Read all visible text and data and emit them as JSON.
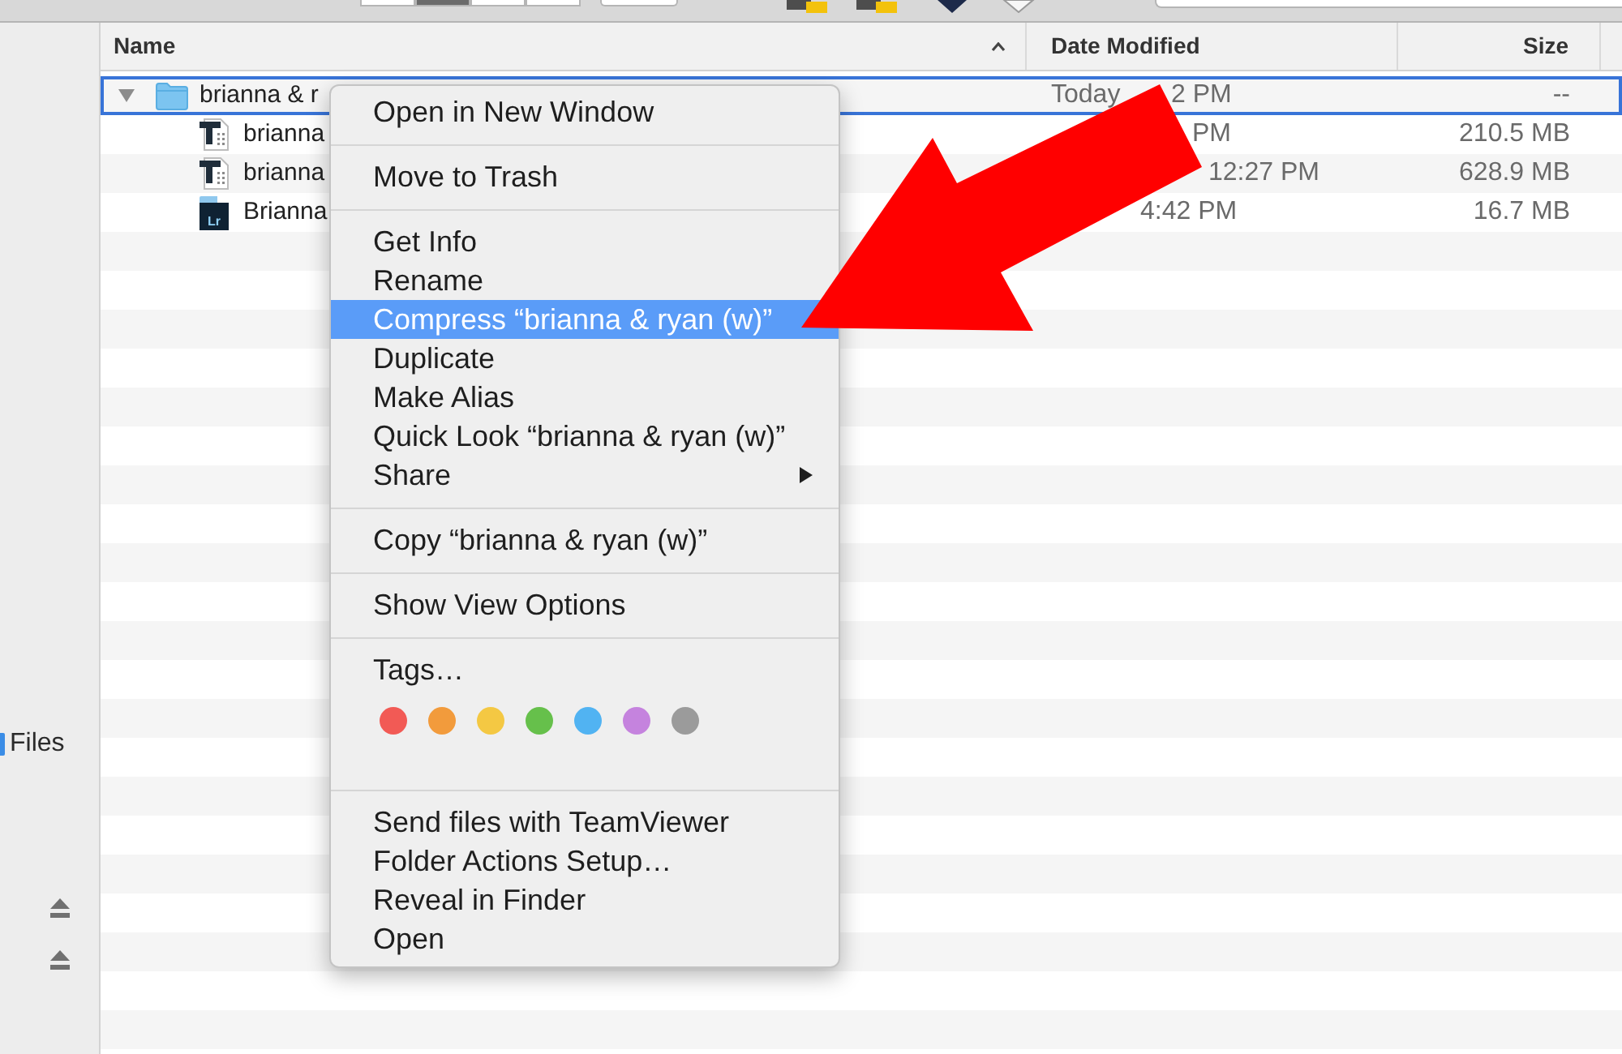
{
  "toolbar": {
    "view_modes": [
      {
        "selected": false
      },
      {
        "selected": true
      },
      {
        "selected": false
      },
      {
        "selected": false
      }
    ]
  },
  "sidebar": {
    "items": [
      {
        "kind": "place",
        "label": "Files"
      },
      {
        "kind": "device"
      },
      {
        "kind": "device"
      }
    ]
  },
  "table": {
    "columns": [
      {
        "label": "Name",
        "sorted": true
      },
      {
        "label": "Date Modified",
        "sorted": false
      },
      {
        "label": "Size",
        "sorted": false
      }
    ],
    "rows": [
      {
        "kind": "folder",
        "name": "brianna & r",
        "expanded": true,
        "selected": true,
        "date_modified": [
          "Today",
          "2 PM"
        ],
        "size": "--",
        "children": [
          {
            "kind": "document",
            "name": "brianna",
            "selected": false,
            "date_modified": [
              "PM"
            ],
            "size": "210.5 MB"
          },
          {
            "kind": "document",
            "name": "brianna",
            "selected": false,
            "date_modified": [
              "12:27 PM"
            ],
            "size": "628.9 MB"
          },
          {
            "kind": "catalog",
            "name": "Brianna",
            "icon_label": "Lr",
            "selected": false,
            "date_modified": [
              "4:42 PM"
            ],
            "size": "16.7 MB"
          }
        ]
      }
    ]
  },
  "context_menu": {
    "items": [
      {
        "kind": "item",
        "label": "Open in New Window",
        "selected": false,
        "submenu": false
      },
      {
        "kind": "separator"
      },
      {
        "kind": "item",
        "label": "Move to Trash",
        "selected": false,
        "submenu": false
      },
      {
        "kind": "separator"
      },
      {
        "kind": "item",
        "label": "Get Info",
        "selected": false,
        "submenu": false
      },
      {
        "kind": "item",
        "label": "Rename",
        "selected": false,
        "submenu": false
      },
      {
        "kind": "item",
        "label": "Compress “brianna & ryan (w)”",
        "selected": true,
        "submenu": false
      },
      {
        "kind": "item",
        "label": "Duplicate",
        "selected": false,
        "submenu": false
      },
      {
        "kind": "item",
        "label": "Make Alias",
        "selected": false,
        "submenu": false
      },
      {
        "kind": "item",
        "label": "Quick Look “brianna & ryan (w)”",
        "selected": false,
        "submenu": false
      },
      {
        "kind": "item",
        "label": "Share",
        "selected": false,
        "submenu": true
      },
      {
        "kind": "separator"
      },
      {
        "kind": "item",
        "label": "Copy “brianna & ryan (w)”",
        "selected": false,
        "submenu": false
      },
      {
        "kind": "separator"
      },
      {
        "kind": "item",
        "label": "Show View Options",
        "selected": false,
        "submenu": false
      },
      {
        "kind": "separator"
      },
      {
        "kind": "item",
        "label": "Tags…",
        "selected": false,
        "submenu": false
      },
      {
        "kind": "tag_colors",
        "colors": [
          {
            "color": "#f25a55"
          },
          {
            "color": "#f29b3c"
          },
          {
            "color": "#f4c843"
          },
          {
            "color": "#66c04b"
          },
          {
            "color": "#51b3f2"
          },
          {
            "color": "#c583de"
          },
          {
            "color": "#9b9b9b"
          }
        ]
      },
      {
        "kind": "separator"
      },
      {
        "kind": "item",
        "label": "Send files with TeamViewer",
        "selected": false,
        "submenu": false
      },
      {
        "kind": "item",
        "label": "Folder Actions Setup…",
        "selected": false,
        "submenu": false
      },
      {
        "kind": "item",
        "label": "Reveal in Finder",
        "selected": false,
        "submenu": false
      },
      {
        "kind": "item",
        "label": "Open",
        "selected": false,
        "submenu": false
      }
    ]
  }
}
